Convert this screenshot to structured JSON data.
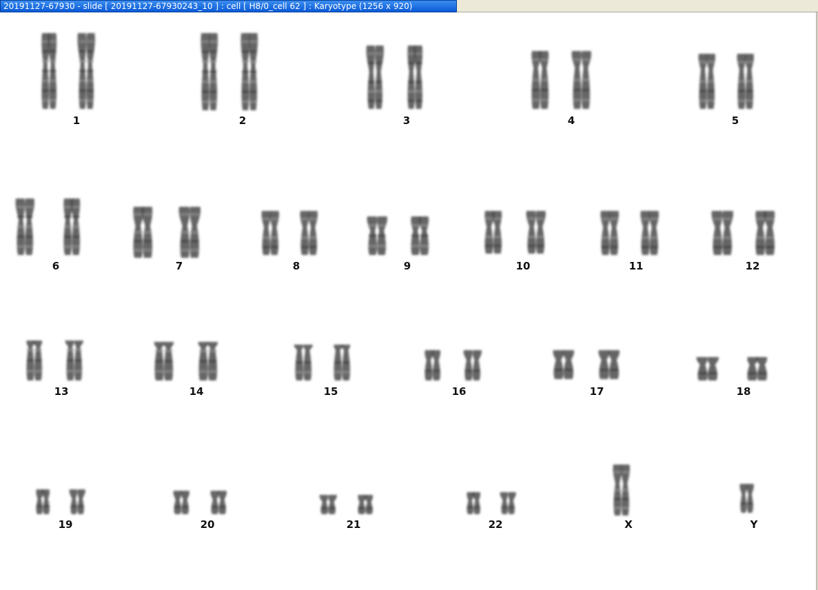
{
  "window": {
    "title": "20191127-67930 - slide [  20191127-67930243_10 ] : cell [ H8/0_cell 62 ] : Karyotype  (1256 x 920)"
  },
  "karyotype": {
    "chromosome_color": "#4a4a4a",
    "labels": [
      "1",
      "2",
      "3",
      "4",
      "5",
      "6",
      "7",
      "8",
      "9",
      "10",
      "11",
      "12",
      "13",
      "14",
      "15",
      "16",
      "17",
      "18",
      "19",
      "20",
      "21",
      "22",
      "X",
      "Y"
    ]
  }
}
